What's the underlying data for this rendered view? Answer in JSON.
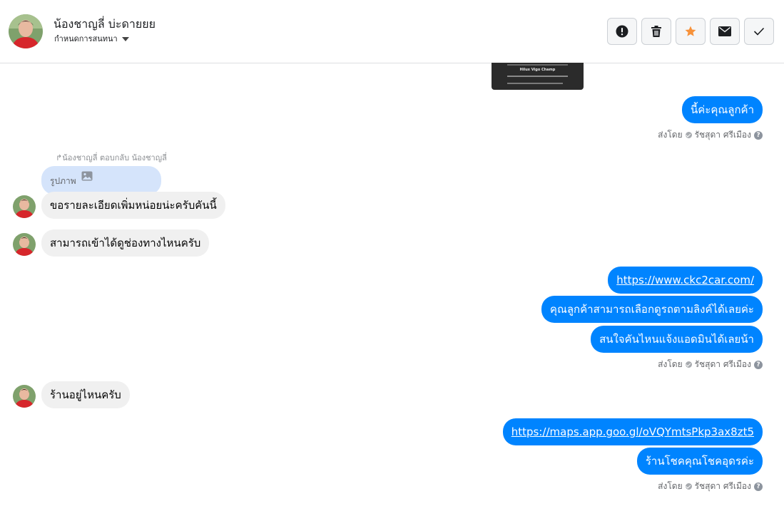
{
  "header": {
    "name": "น้องชาญลี่ บ่ะดายยย",
    "subtitle": "กำหนดการสนทนา",
    "actions": [
      "alert-icon",
      "trash-icon",
      "star-icon",
      "envelope-icon",
      "check-icon"
    ]
  },
  "colors": {
    "outgoing": "#0084ff",
    "incoming": "#f0f0f0",
    "reply_quote": "#d5e4fb",
    "star": "#f7923a"
  },
  "messages": {
    "m1": "นี้ค่ะคุณลูกค้า",
    "reply_meta": "น้องชาญลี่ ตอบกลับ น้องชาญลี่",
    "reply_label": "รูปภาพ",
    "m2": "ขอรายละเอียดเพิ่มหน่อยน่ะครับคันนี้",
    "m3": "สามารถเข้าได้ดูช่องทางไหนครับ",
    "m4": "https://www.ckc2car.com/",
    "m5": "คุณลูกค้าสามารถเลือกดูรถตามลิงค์ได้เลยค่ะ",
    "m6": "สนใจคันไหนแจ้งแอดมินได้เลยน้า",
    "m7": "ร้านอยู่ไหนครับ",
    "m8": "https://maps.app.goo.gl/oVQYmtsPkp3ax8zt5",
    "m9": "ร้านโชคคุณโชคอุดรค่ะ"
  },
  "sent_by": {
    "prefix": "ส่งโดย",
    "agent": "รัชสุดา ศรีเมือง"
  },
  "thumbnail": {
    "title": "Hilux Vigo Champ"
  }
}
